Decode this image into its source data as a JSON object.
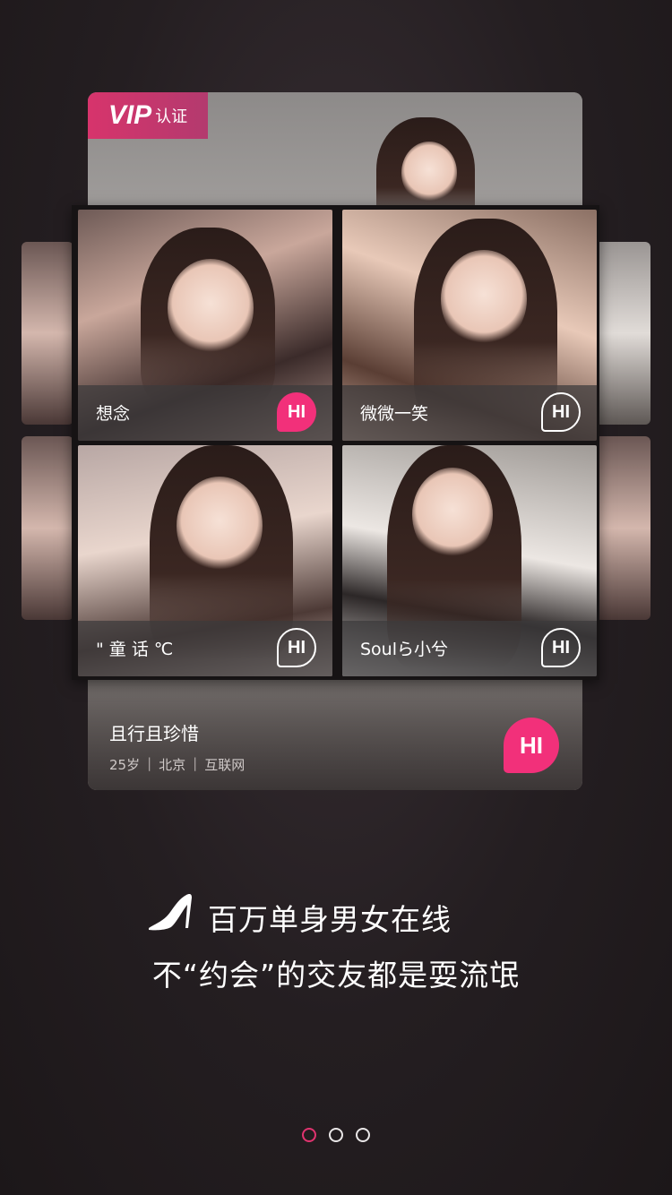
{
  "back_card": {
    "badge_vip": "VIP",
    "badge_cert": "认证",
    "name": "且行且珍惜",
    "age": "25岁",
    "city": "北京",
    "industry": "互联网",
    "sep": "|",
    "hi_label": "HI"
  },
  "tiles": [
    {
      "name": "想念",
      "hi_label": "HI",
      "style": "filled"
    },
    {
      "name": "微微一笑",
      "hi_label": "HI",
      "style": "outline"
    },
    {
      "name": "\" 童 话 ℃",
      "hi_label": "HI",
      "style": "outline"
    },
    {
      "name": "Soulら小兮",
      "hi_label": "HI",
      "style": "outline"
    }
  ],
  "headline": {
    "line1": "百万单身男女在线",
    "line2": "不“约会”的交友都是耍流氓",
    "icon": "high-heel-icon"
  },
  "pager": {
    "count": 3,
    "active_index": 0
  },
  "colors": {
    "accent": "#f2307a",
    "background": "#241e21"
  }
}
